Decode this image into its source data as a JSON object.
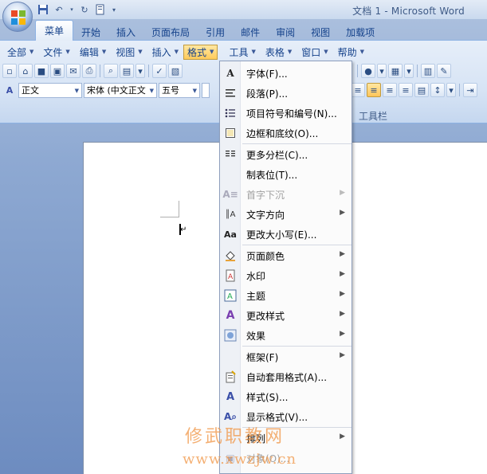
{
  "window": {
    "title": "文档 1 - Microsoft Word"
  },
  "quick_access": {
    "icons": [
      "save-icon",
      "undo-icon",
      "redo-icon",
      "print-preview-icon",
      "customize-icon"
    ]
  },
  "ribbon_tabs": [
    "菜单",
    "开始",
    "插入",
    "页面布局",
    "引用",
    "邮件",
    "审阅",
    "视图",
    "加载项"
  ],
  "active_tab": "菜单",
  "menubar": [
    "全部",
    "文件",
    "编辑",
    "视图",
    "插入",
    "格式",
    "工具",
    "表格",
    "窗口",
    "帮助"
  ],
  "open_menu": "格式",
  "toolbar2": {
    "style_combo": "正文",
    "font_combo": "宋体 (中文正文",
    "size_combo": "五号"
  },
  "group_label": "工具栏",
  "format_menu": {
    "items": [
      {
        "label": "字体(F)...",
        "icon": "font-icon",
        "enabled": true,
        "submenu": false
      },
      {
        "label": "段落(P)...",
        "icon": "paragraph-icon",
        "enabled": true,
        "submenu": false
      },
      {
        "label": "项目符号和编号(N)...",
        "icon": "bullets-icon",
        "enabled": true,
        "submenu": false
      },
      {
        "label": "边框和底纹(O)...",
        "icon": "borders-icon",
        "enabled": true,
        "submenu": false
      },
      {
        "label": "更多分栏(C)...",
        "icon": "columns-icon",
        "enabled": true,
        "submenu": false
      },
      {
        "label": "制表位(T)...",
        "icon": "",
        "enabled": true,
        "submenu": false
      },
      {
        "label": "首字下沉",
        "icon": "drop-cap-icon",
        "enabled": false,
        "submenu": true
      },
      {
        "label": "文字方向",
        "icon": "text-direction-icon",
        "enabled": true,
        "submenu": true
      },
      {
        "label": "更改大小写(E)...",
        "icon": "change-case-icon",
        "enabled": true,
        "submenu": false
      },
      {
        "label": "页面颜色",
        "icon": "page-color-icon",
        "enabled": true,
        "submenu": true
      },
      {
        "label": "水印",
        "icon": "watermark-icon",
        "enabled": true,
        "submenu": true
      },
      {
        "label": "主题",
        "icon": "theme-icon",
        "enabled": true,
        "submenu": true
      },
      {
        "label": "更改样式",
        "icon": "change-styles-icon",
        "enabled": true,
        "submenu": true
      },
      {
        "label": "效果",
        "icon": "effects-icon",
        "enabled": true,
        "submenu": true
      },
      {
        "label": "框架(F)",
        "icon": "",
        "enabled": true,
        "submenu": true
      },
      {
        "label": "自动套用格式(A)...",
        "icon": "autoformat-icon",
        "enabled": true,
        "submenu": false
      },
      {
        "label": "样式(S)...",
        "icon": "styles-icon",
        "enabled": true,
        "submenu": false
      },
      {
        "label": "显示格式(V)...",
        "icon": "reveal-formatting-icon",
        "enabled": true,
        "submenu": false
      },
      {
        "label": "排列",
        "icon": "",
        "enabled": true,
        "submenu": true
      },
      {
        "label": "对象(O)...",
        "icon": "object-icon",
        "enabled": false,
        "submenu": false
      }
    ]
  },
  "watermark": {
    "line1": "修武职教网",
    "line2": "www.xwzjw.cn"
  }
}
